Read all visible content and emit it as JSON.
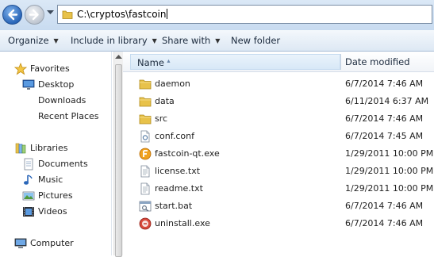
{
  "address": {
    "path": "C:\\cryptos\\fastcoin",
    "back_icon": "back-arrow-icon",
    "forward_icon": "forward-arrow-icon"
  },
  "toolbar": {
    "organize": "Organize",
    "include_in_library": "Include in library",
    "share_with": "Share with",
    "new_folder": "New folder"
  },
  "nav": {
    "favorites": {
      "label": "Favorites",
      "icon": "star-icon"
    },
    "favorite_items": [
      {
        "label": "Desktop",
        "icon": "desktop-icon"
      },
      {
        "label": "Downloads",
        "icon": "downloads-icon"
      },
      {
        "label": "Recent Places",
        "icon": "recent-places-icon"
      }
    ],
    "libraries": {
      "label": "Libraries",
      "icon": "libraries-icon"
    },
    "library_items": [
      {
        "label": "Documents",
        "icon": "documents-icon"
      },
      {
        "label": "Music",
        "icon": "music-icon"
      },
      {
        "label": "Pictures",
        "icon": "pictures-icon"
      },
      {
        "label": "Videos",
        "icon": "videos-icon"
      }
    ],
    "computer": {
      "label": "Computer",
      "icon": "computer-icon"
    }
  },
  "columns": {
    "name": "Name",
    "date_modified": "Date modified"
  },
  "files": [
    {
      "name": "daemon",
      "date": "6/7/2014 7:46 AM",
      "icon": "folder-icon"
    },
    {
      "name": "data",
      "date": "6/11/2014 6:37 AM",
      "icon": "folder-icon"
    },
    {
      "name": "src",
      "date": "6/7/2014 7:46 AM",
      "icon": "folder-icon"
    },
    {
      "name": "conf.conf",
      "date": "6/7/2014 7:45 AM",
      "icon": "config-file-icon"
    },
    {
      "name": "fastcoin-qt.exe",
      "date": "1/29/2011 10:00 PM",
      "icon": "fastcoin-app-icon"
    },
    {
      "name": "license.txt",
      "date": "1/29/2011 10:00 PM",
      "icon": "text-file-icon"
    },
    {
      "name": "readme.txt",
      "date": "1/29/2011 10:00 PM",
      "icon": "text-file-icon"
    },
    {
      "name": "start.bat",
      "date": "6/7/2014 7:46 AM",
      "icon": "batch-file-icon"
    },
    {
      "name": "uninstall.exe",
      "date": "6/7/2014 7:46 AM",
      "icon": "uninstall-app-icon"
    }
  ],
  "colors": {
    "folder": "#e8c24a",
    "accent": "#2a66b8",
    "header_hover": "#d8e8f7"
  }
}
